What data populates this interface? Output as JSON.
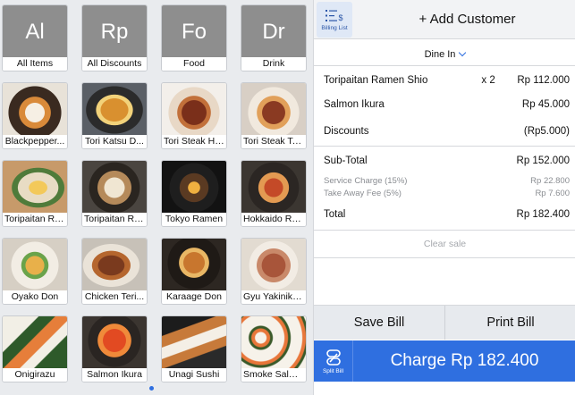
{
  "categories": [
    {
      "abbr": "Al",
      "label": "All Items"
    },
    {
      "abbr": "Rp",
      "label": "All Discounts"
    },
    {
      "abbr": "Fo",
      "label": "Food"
    },
    {
      "abbr": "Dr",
      "label": "Drink"
    }
  ],
  "items": [
    {
      "label": "Blackpepper..."
    },
    {
      "label": "Tori Katsu D..."
    },
    {
      "label": "Tori Steak Hi..."
    },
    {
      "label": "Tori Steak Te..."
    },
    {
      "label": "Toripaitan Ra..."
    },
    {
      "label": "Toripaitan Ra..."
    },
    {
      "label": "Tokyo Ramen"
    },
    {
      "label": "Hokkaido Ra..."
    },
    {
      "label": "Oyako Don"
    },
    {
      "label": "Chicken Teri..."
    },
    {
      "label": "Karaage Don"
    },
    {
      "label": "Gyu Yakiniku..."
    },
    {
      "label": "Onigirazu"
    },
    {
      "label": "Salmon Ikura"
    },
    {
      "label": "Unagi Sushi"
    },
    {
      "label": "Smoke Salm..."
    }
  ],
  "header": {
    "billing_label": "Billing List",
    "add_customer": "+ Add Customer"
  },
  "order_type": "Dine In",
  "cart": {
    "lines": [
      {
        "name": "Toripaitan Ramen Shio",
        "qty": "x 2",
        "amount": "Rp 112.000"
      },
      {
        "name": "Salmon Ikura",
        "qty": "",
        "amount": "Rp 45.000"
      }
    ],
    "discounts_label": "Discounts",
    "discounts_value": "(Rp5.000)",
    "subtotal_label": "Sub-Total",
    "subtotal_value": "Rp 152.000",
    "service_label": "Service Charge (15%)",
    "service_value": "Rp 22.800",
    "takeaway_label": "Take Away Fee (5%)",
    "takeaway_value": "Rp 7.600",
    "total_label": "Total",
    "total_value": "Rp 182.400"
  },
  "clear_sale": "Clear sale",
  "buttons": {
    "save_bill": "Save Bill",
    "print_bill": "Print Bill",
    "split_bill": "Split Bill",
    "charge": "Charge Rp 182.400"
  },
  "colors": {
    "accent": "#2f6fe0",
    "category_tile": "#8e8e8e"
  },
  "icons": {
    "billing": "billing-list-icon",
    "split": "split-bill-icon",
    "chevron": "chevron-down-icon"
  }
}
